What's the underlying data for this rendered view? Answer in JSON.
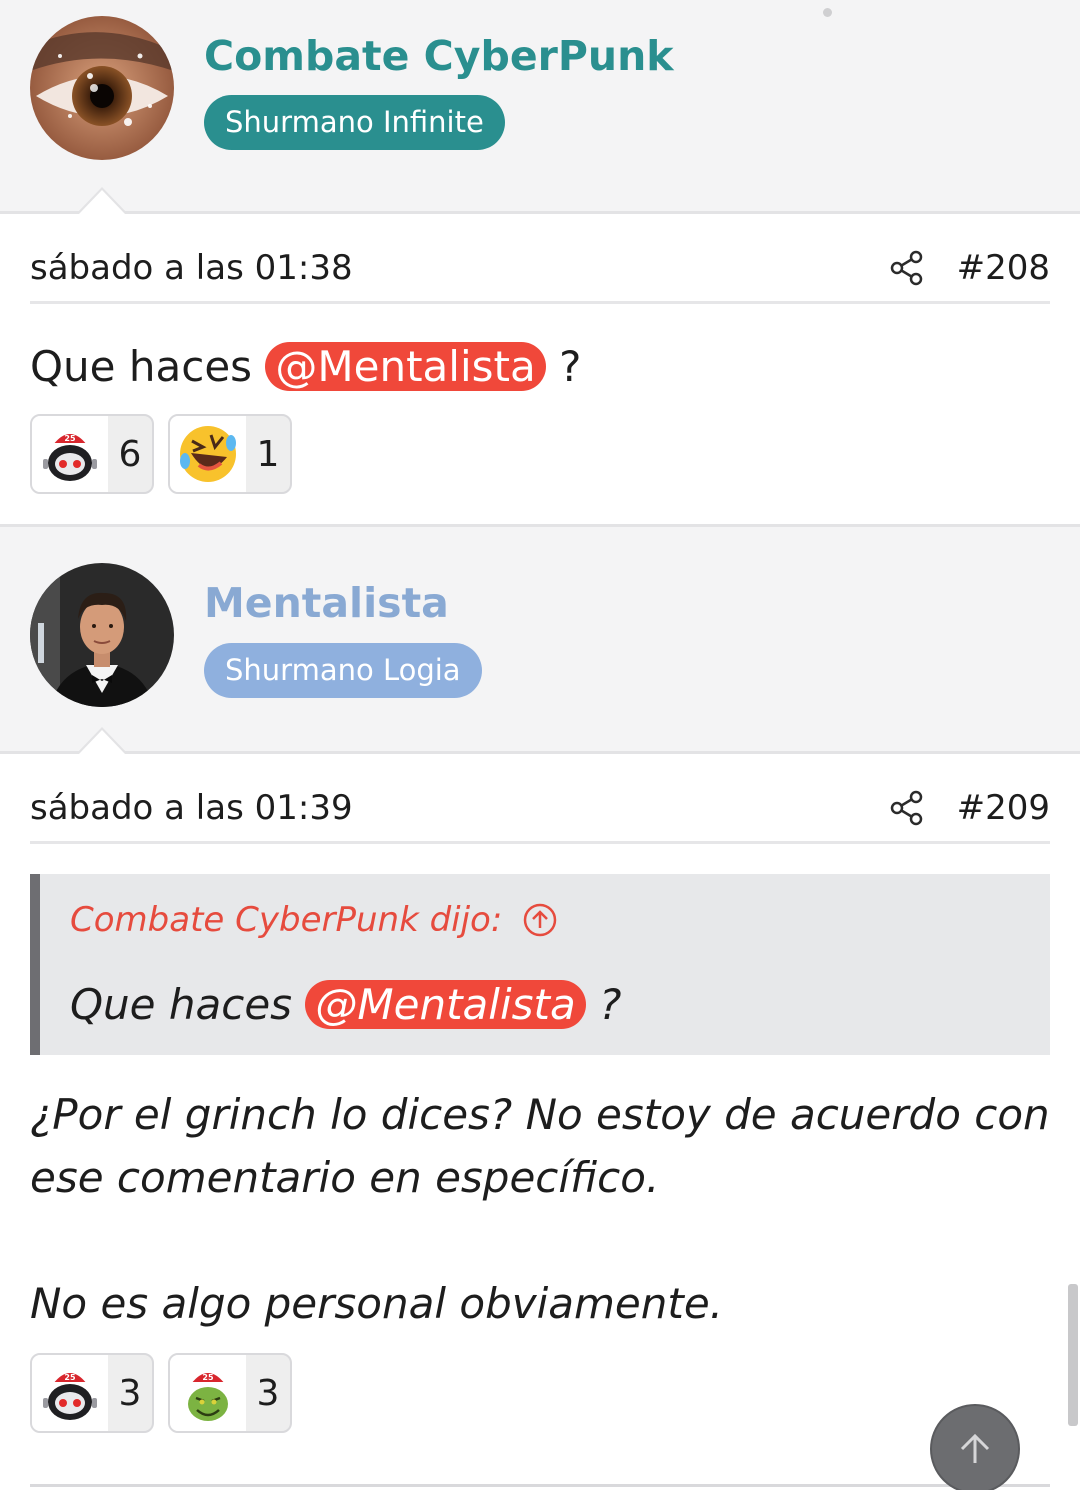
{
  "posts": [
    {
      "author": "Combate CyberPunk",
      "badge": "Shurmano Infinite",
      "date": "sábado a las 01:38",
      "number": "#208",
      "text_before": "Que haces ",
      "mention": "@Mentalista",
      "text_after": " ?",
      "reactions": [
        {
          "icon": "robot-santa-icon",
          "count": "6"
        },
        {
          "icon": "rofl-emoji-icon",
          "count": "1"
        }
      ]
    },
    {
      "author": "Mentalista",
      "badge": "Shurmano Logia",
      "date": "sábado a las 01:39",
      "number": "#209",
      "quote": {
        "header": "Combate CyberPunk dijo:",
        "text_before": "Que haces ",
        "mention": "@Mentalista",
        "text_after": " ?"
      },
      "paragraphs": [
        "¿Por el grinch lo dices? No estoy de acuerdo con ese comentario en específico.",
        "No es algo personal obviamente."
      ],
      "reactions": [
        {
          "icon": "robot-santa-icon",
          "count": "3"
        },
        {
          "icon": "grinch-santa-icon",
          "count": "3"
        }
      ]
    }
  ],
  "colors": {
    "author1": "#2a8f8f",
    "author2": "#89a9d3",
    "mention": "#f0483a",
    "quote_header": "#e64b3e"
  }
}
